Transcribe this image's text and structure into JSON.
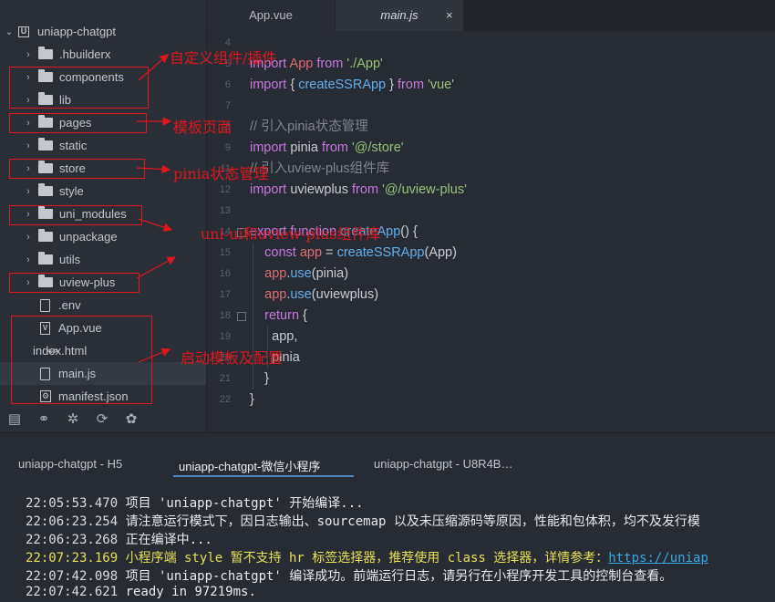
{
  "sidebar": {
    "project": "uniapp-chatgpt",
    "items": [
      {
        "label": ".hbuilderx",
        "kind": "folder",
        "icon": "folder-icon"
      },
      {
        "label": "components",
        "kind": "folder",
        "icon": "folder-icon"
      },
      {
        "label": "lib",
        "kind": "folder",
        "icon": "folder-icon"
      },
      {
        "label": "pages",
        "kind": "folder",
        "icon": "folder-icon"
      },
      {
        "label": "static",
        "kind": "folder",
        "icon": "folder-icon"
      },
      {
        "label": "store",
        "kind": "folder",
        "icon": "folder-icon"
      },
      {
        "label": "style",
        "kind": "folder",
        "icon": "folder-icon"
      },
      {
        "label": "uni_modules",
        "kind": "folder",
        "icon": "folder-icon"
      },
      {
        "label": "unpackage",
        "kind": "folder",
        "icon": "folder-icon"
      },
      {
        "label": "utils",
        "kind": "folder",
        "icon": "folder-icon"
      },
      {
        "label": "uview-plus",
        "kind": "folder",
        "icon": "folder-icon"
      },
      {
        "label": ".env",
        "kind": "file",
        "icon": "file-icon"
      },
      {
        "label": "App.vue",
        "kind": "vue",
        "icon": "vue-file-icon"
      },
      {
        "label": "index.html",
        "kind": "code",
        "icon": "html-file-icon"
      },
      {
        "label": "main.js",
        "kind": "file",
        "icon": "js-file-icon",
        "selected": true
      },
      {
        "label": "manifest.json",
        "kind": "gear",
        "icon": "json-file-icon"
      }
    ],
    "bottom_icons": [
      "file-tree-icon",
      "binoculars-icon",
      "bug-icon",
      "source-control-icon",
      "plugin-icon"
    ]
  },
  "tabs": [
    {
      "label": "App.vue",
      "active": false
    },
    {
      "label": "main.js",
      "active": true
    }
  ],
  "tab_close": "×",
  "editor": {
    "lines": [
      {
        "n": "4",
        "tokens": []
      },
      {
        "n": "5",
        "tokens": [
          [
            "kw",
            "import"
          ],
          [
            "plain",
            " "
          ],
          [
            "var",
            "App"
          ],
          [
            "plain",
            " "
          ],
          [
            "kw",
            "from"
          ],
          [
            "plain",
            " "
          ],
          [
            "str",
            "'./App'"
          ]
        ]
      },
      {
        "n": "6",
        "tokens": [
          [
            "kw",
            "import"
          ],
          [
            "plain",
            " { "
          ],
          [
            "fn",
            "createSSRApp"
          ],
          [
            "plain",
            " } "
          ],
          [
            "kw",
            "from"
          ],
          [
            "plain",
            " "
          ],
          [
            "str",
            "'vue'"
          ]
        ]
      },
      {
        "n": "7",
        "tokens": []
      },
      {
        "n": "8",
        "tokens": [
          [
            "cm",
            "// 引入pinia状态管理"
          ]
        ]
      },
      {
        "n": "9",
        "tokens": [
          [
            "kw",
            "import"
          ],
          [
            "plain",
            " pinia "
          ],
          [
            "kw",
            "from"
          ],
          [
            "plain",
            " "
          ],
          [
            "str",
            "'@/store'"
          ]
        ]
      },
      {
        "n": "11",
        "tokens": [
          [
            "cm",
            "// 引入uview-plus组件库"
          ]
        ]
      },
      {
        "n": "12",
        "tokens": [
          [
            "kw",
            "import"
          ],
          [
            "plain",
            " uviewplus "
          ],
          [
            "kw",
            "from"
          ],
          [
            "plain",
            " "
          ],
          [
            "str",
            "'@/uview-plus'"
          ]
        ]
      },
      {
        "n": "13",
        "tokens": []
      },
      {
        "n": "14",
        "tokens": [
          [
            "kw",
            "export"
          ],
          [
            "plain",
            " "
          ],
          [
            "kw",
            "function"
          ],
          [
            "plain",
            " "
          ],
          [
            "fn",
            "createApp"
          ],
          [
            "plain",
            "() {"
          ]
        ],
        "fold": true
      },
      {
        "n": "15",
        "tokens": [
          [
            "plain",
            "    "
          ],
          [
            "kw",
            "const"
          ],
          [
            "plain",
            " "
          ],
          [
            "var",
            "app"
          ],
          [
            "plain",
            " = "
          ],
          [
            "fn",
            "createSSRApp"
          ],
          [
            "plain",
            "(App)"
          ]
        ]
      },
      {
        "n": "16",
        "tokens": [
          [
            "plain",
            "    "
          ],
          [
            "var",
            "app"
          ],
          [
            "plain",
            "."
          ],
          [
            "fn",
            "use"
          ],
          [
            "plain",
            "(pinia)"
          ]
        ]
      },
      {
        "n": "17",
        "tokens": [
          [
            "plain",
            "    "
          ],
          [
            "var",
            "app"
          ],
          [
            "plain",
            "."
          ],
          [
            "fn",
            "use"
          ],
          [
            "plain",
            "(uviewplus)"
          ]
        ]
      },
      {
        "n": "18",
        "tokens": [
          [
            "plain",
            "    "
          ],
          [
            "kw",
            "return"
          ],
          [
            "plain",
            " {"
          ]
        ],
        "fold": true
      },
      {
        "n": "19",
        "tokens": [
          [
            "plain",
            "      app,"
          ]
        ]
      },
      {
        "n": "20",
        "tokens": [
          [
            "plain",
            "      pinia"
          ]
        ]
      },
      {
        "n": "21",
        "tokens": [
          [
            "plain",
            "    }"
          ]
        ]
      },
      {
        "n": "22",
        "tokens": [
          [
            "plain",
            "}"
          ]
        ]
      }
    ]
  },
  "annotations": [
    "自定义组件/插件",
    "模板页面",
    "pinia状态管理",
    "uni-ui和uview-plus组件库",
    "启动模板及配置"
  ],
  "console": {
    "tabs": [
      {
        "label": "uniapp-chatgpt - H5",
        "active": false
      },
      {
        "label": "uniapp-chatgpt-微信小程序",
        "active": true
      },
      {
        "label": "uniapp-chatgpt - U8R4B…",
        "active": false
      }
    ],
    "logs": [
      {
        "time": "22:05:53.470",
        "text": "项目 'uniapp-chatgpt' 开始编译...",
        "type": "normal"
      },
      {
        "time": "22:06:23.254",
        "text": "请注意运行模式下，因日志输出、sourcemap 以及未压缩源码等原因，性能和包体积，均不及发行模",
        "type": "normal"
      },
      {
        "time": "22:06:23.268",
        "text": "正在编译中...",
        "type": "normal"
      },
      {
        "time": "22:07:23.169",
        "text": "小程序端 style 暂不支持 hr 标签选择器，推荐使用 class 选择器，详情参考：",
        "link": "https://uniap",
        "type": "warn"
      },
      {
        "time": "22:07:42.098",
        "text": "项目 'uniapp-chatgpt' 编译成功。前端运行日志，请另行在小程序开发工具的控制台查看。",
        "type": "normal"
      },
      {
        "time": "22:07:42.621",
        "text": "ready in 97219ms.",
        "type": "normal"
      }
    ]
  },
  "colors": {
    "keyword": "#c678dd",
    "function": "#61afef",
    "string": "#98c379",
    "variable": "#e06c75",
    "comment": "#7f848e",
    "plain": "#c8ccd4",
    "annotation": "#e0171f",
    "warn": "#e7e055",
    "link": "#3aa8e6"
  }
}
